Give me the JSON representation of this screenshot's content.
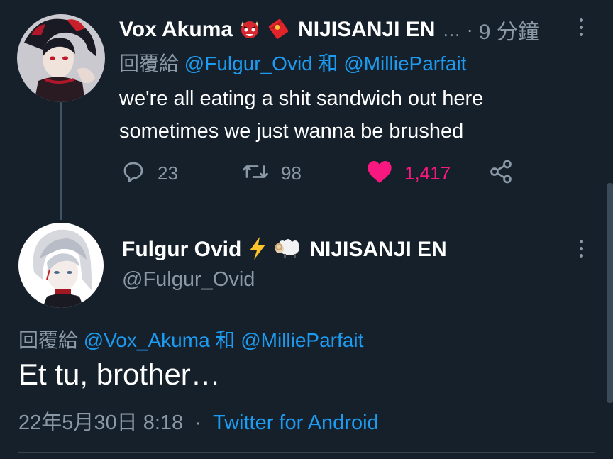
{
  "tweet1": {
    "author_name": "Vox Akuma",
    "author_suffix": "NIJISANJI EN",
    "ellipsis": "…",
    "separator": "·",
    "time_ago": "9 分鐘",
    "reply_prefix": "回覆給",
    "reply_user1": "@Fulgur_Ovid",
    "reply_joiner": "和",
    "reply_user2": "@MillieParfait",
    "text_line1": "we're all eating a shit sandwich out here",
    "text_line2": "sometimes we just wanna be brushed",
    "replies": "23",
    "retweets": "98",
    "likes": "1,417",
    "liked": true,
    "icons": [
      "ogre-emoji-icon",
      "red-envelope-emoji-icon",
      "reply-icon",
      "retweet-icon",
      "heart-icon",
      "share-icon",
      "more-icon"
    ]
  },
  "tweet2": {
    "author_name": "Fulgur Ovid",
    "author_suffix": "NIJISANJI EN",
    "handle": "@Fulgur_Ovid",
    "reply_prefix": "回覆給",
    "reply_user1": "@Vox_Akuma",
    "reply_joiner": "和",
    "reply_user2": "@MillieParfait",
    "text": "Et tu, brother…",
    "date": "22年5月30日 8:18",
    "separator": "·",
    "source": "Twitter for Android",
    "icons": [
      "lightning-emoji-icon",
      "ram-emoji-icon",
      "more-icon"
    ]
  },
  "colors": {
    "background": "#15202b",
    "text": "#ffffff",
    "muted": "#8b98a5",
    "link": "#1d9bf0",
    "like": "#f91880",
    "thread_line": "#3d5466"
  }
}
